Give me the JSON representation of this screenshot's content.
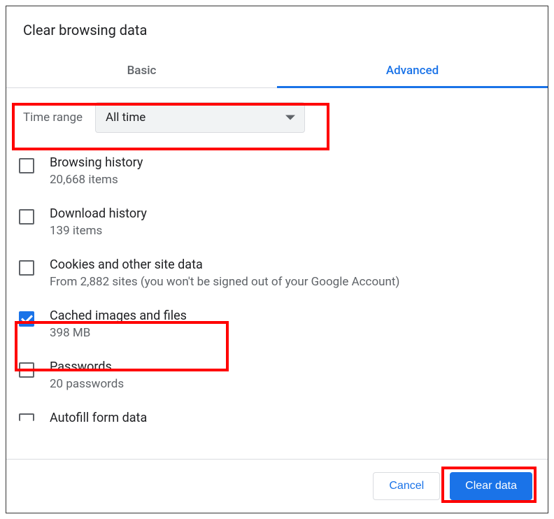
{
  "dialog": {
    "title": "Clear browsing data"
  },
  "tabs": {
    "basic": "Basic",
    "advanced": "Advanced"
  },
  "timeRange": {
    "label": "Time range",
    "value": "All time"
  },
  "items": [
    {
      "title": "Browsing history",
      "sub": "20,668 items",
      "checked": false
    },
    {
      "title": "Download history",
      "sub": "139 items",
      "checked": false
    },
    {
      "title": "Cookies and other site data",
      "sub": "From 2,882 sites (you won't be signed out of your Google Account)",
      "checked": false
    },
    {
      "title": "Cached images and files",
      "sub": "398 MB",
      "checked": true
    },
    {
      "title": "Passwords",
      "sub": "20 passwords",
      "checked": false
    },
    {
      "title": "Autofill form data",
      "sub": "",
      "checked": false
    }
  ],
  "buttons": {
    "cancel": "Cancel",
    "clear": "Clear data"
  }
}
